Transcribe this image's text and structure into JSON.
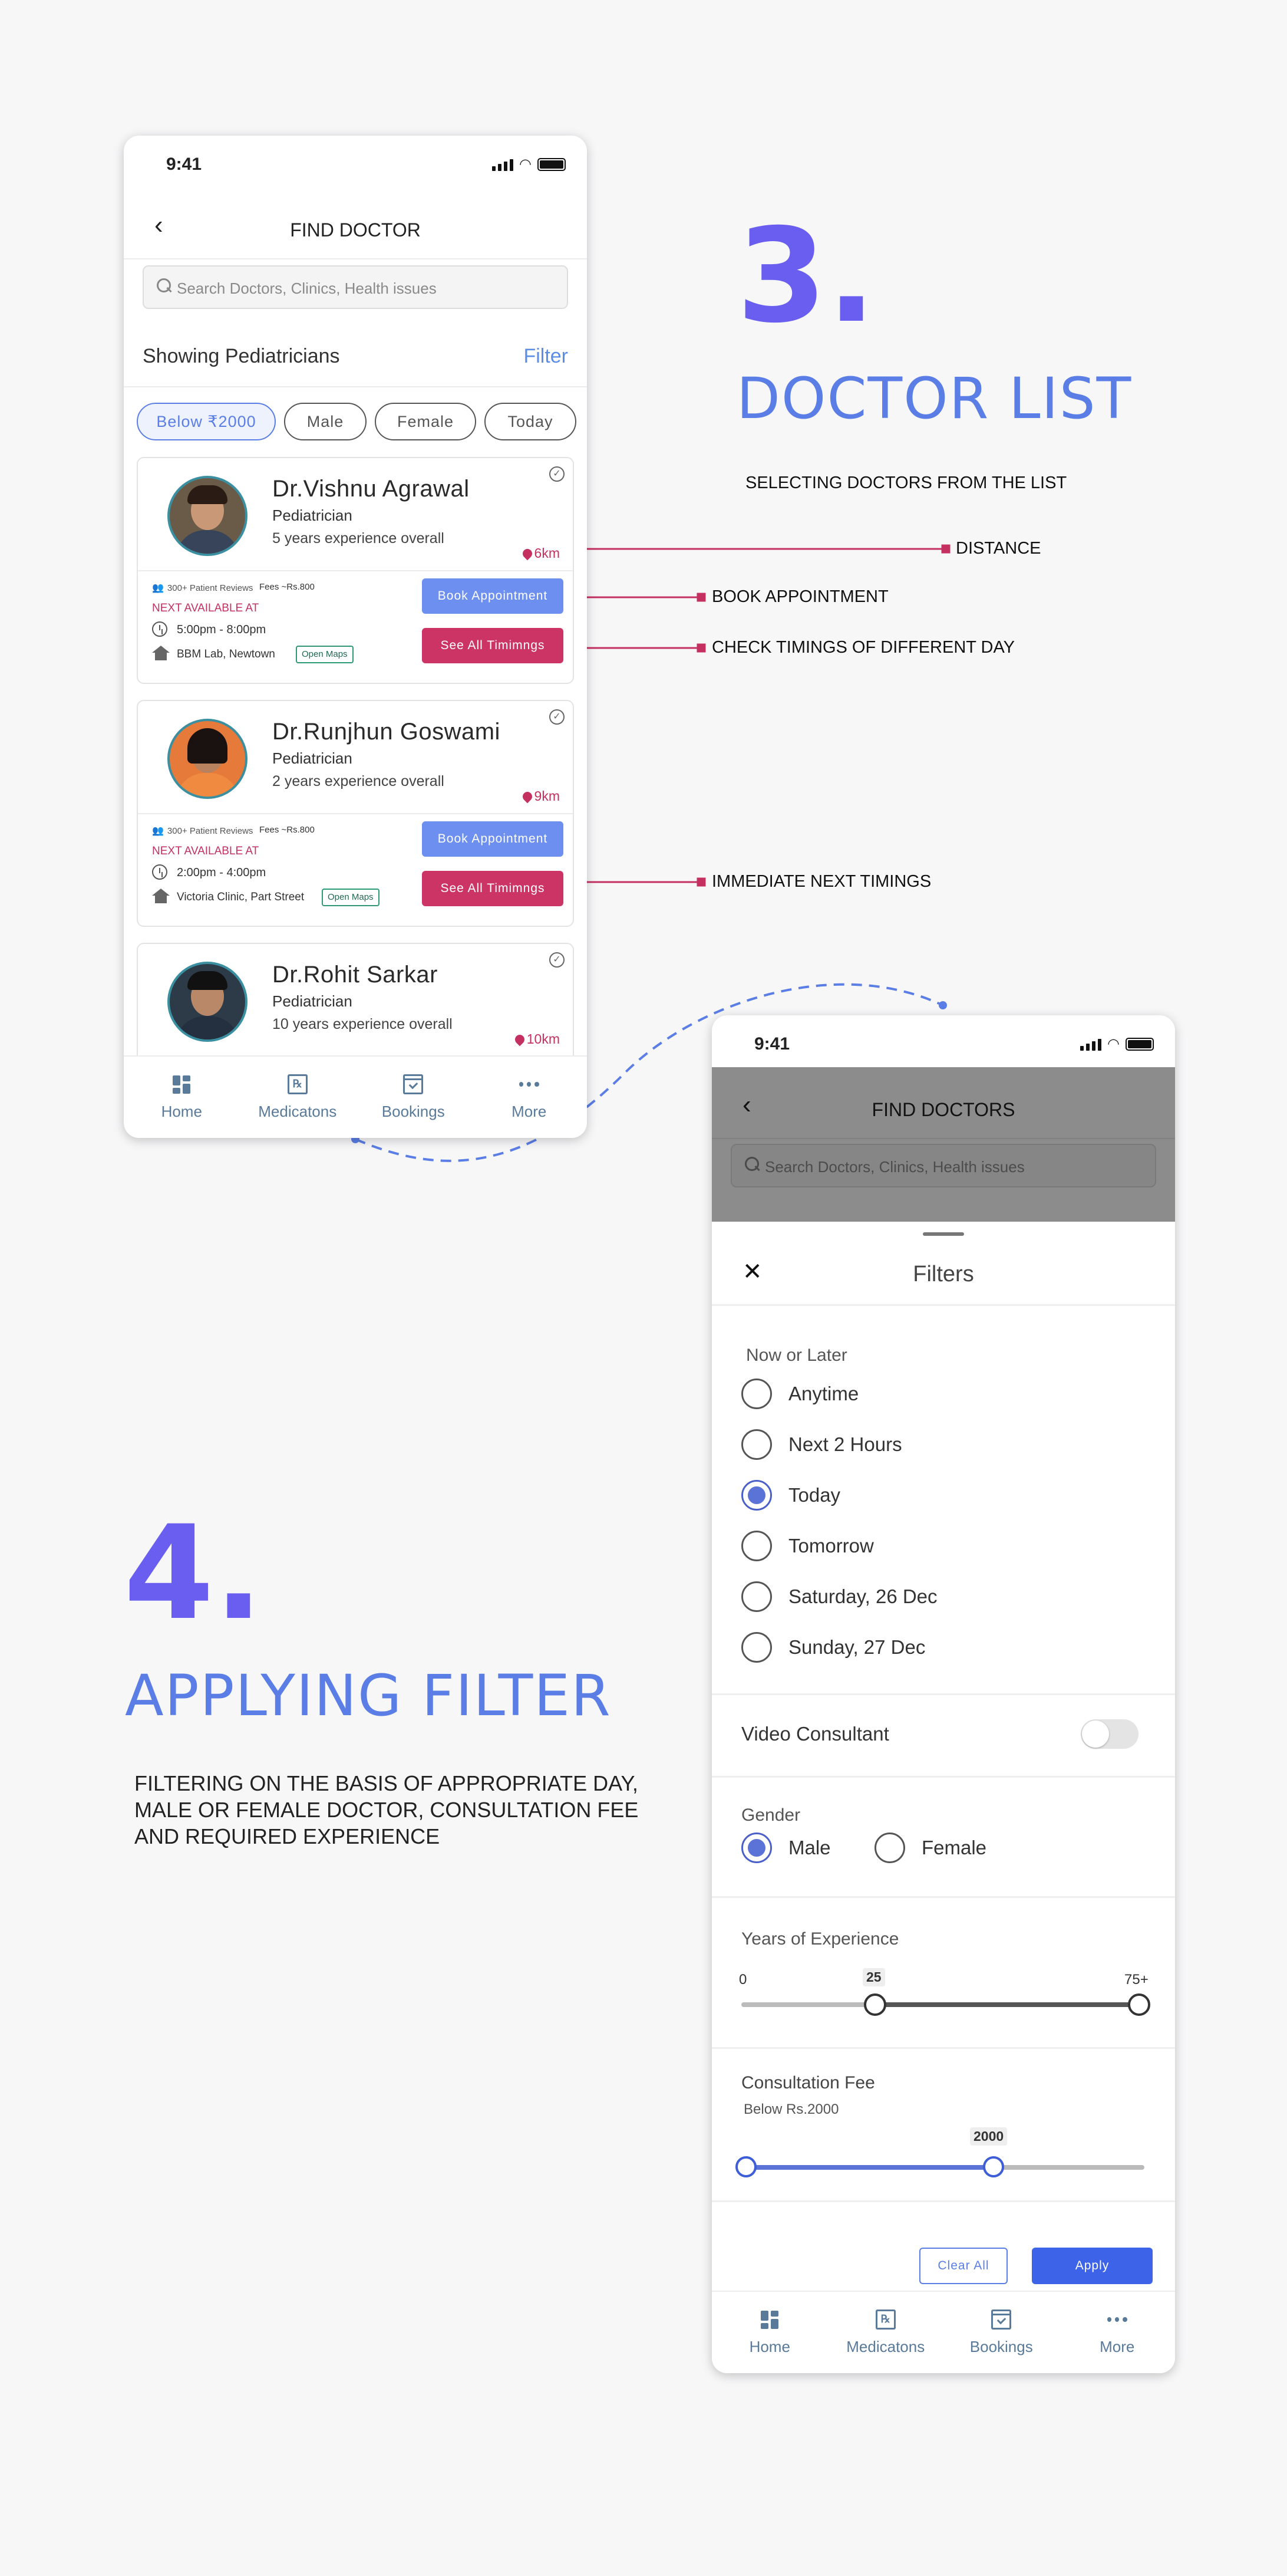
{
  "colors": {
    "accent_blue": "#5b7ee6",
    "accent_purple": "#6a5ef0",
    "pink": "#cc3466",
    "nav": "#5a7a9a"
  },
  "section3": {
    "number": "3.",
    "title": "DOCTOR LIST",
    "subtitle": "SELECTING DOCTORS FROM THE LIST",
    "annotations": {
      "distance": "DISTANCE",
      "book": "BOOK APPOINTMENT",
      "timings": "CHECK TIMINGS OF DIFFERENT DAY",
      "next": "IMMEDIATE NEXT TIMINGS"
    }
  },
  "section4": {
    "number": "4.",
    "title": "APPLYING FILTER",
    "description": [
      "FILTERING ON THE BASIS OF APPROPRIATE DAY,",
      "MALE OR FEMALE DOCTOR, CONSULTATION FEE",
      "AND REQUIRED EXPERIENCE"
    ]
  },
  "phone1": {
    "time": "9:41",
    "header_title": "FIND DOCTOR",
    "search_placeholder": "Search Doctors, Clinics, Health issues",
    "showing": "Showing Pediatricians",
    "filter_label": "Filter",
    "chips": [
      "Below ₹2000",
      "Male",
      "Female",
      "Today"
    ],
    "doctors": [
      {
        "name": "Dr.Vishnu Agrawal",
        "specialty": "Pediatrician",
        "experience": "5 years experience overall",
        "distance": "6km",
        "reviews": "300+ Patient Reviews",
        "fees": "Fees ~Rs.800",
        "next_label": "NEXT AVAILABLE AT",
        "slot": "5:00pm - 8:00pm",
        "clinic": "BBM Lab, Newtown",
        "maps": "Open Maps",
        "book": "Book Appointment",
        "timings": "See All Timimngs"
      },
      {
        "name": "Dr.Runjhun Goswami",
        "specialty": "Pediatrician",
        "experience": "2 years experience overall",
        "distance": "9km",
        "reviews": "300+ Patient Reviews",
        "fees": "Fees ~Rs.800",
        "next_label": "NEXT AVAILABLE AT",
        "slot": "2:00pm - 4:00pm",
        "clinic": "Victoria Clinic, Part Street",
        "maps": "Open Maps",
        "book": "Book Appointment",
        "timings": "See All Timimngs"
      },
      {
        "name": "Dr.Rohit Sarkar",
        "specialty": "Pediatrician",
        "experience": "10 years experience overall",
        "distance": "10km"
      }
    ],
    "nav": [
      "Home",
      "Medicatons",
      "Bookings",
      "More"
    ]
  },
  "phone2": {
    "time": "9:41",
    "header_title": "FIND DOCTORS",
    "search_placeholder": "Search Doctors, Clinics, Health issues",
    "filters_title": "Filters",
    "close": "✕",
    "now_label": "Now or Later",
    "now_options": [
      "Anytime",
      "Next 2 Hours",
      "Today",
      "Tomorrow",
      "Saturday, 26 Dec",
      "Sunday, 27 Dec"
    ],
    "now_selected": 2,
    "video_label": "Video Consultant",
    "video_on": false,
    "gender_label": "Gender",
    "gender_options": [
      "Male",
      "Female"
    ],
    "gender_selected": 0,
    "experience_label": "Years of Experience",
    "experience_min": "0",
    "experience_value": "25",
    "experience_max": "75+",
    "fee_label": "Consultation Fee",
    "fee_sub": "Below Rs.2000",
    "fee_value": "2000",
    "clear": "Clear All",
    "apply": "Apply",
    "nav": [
      "Home",
      "Medicatons",
      "Bookings",
      "More"
    ]
  }
}
